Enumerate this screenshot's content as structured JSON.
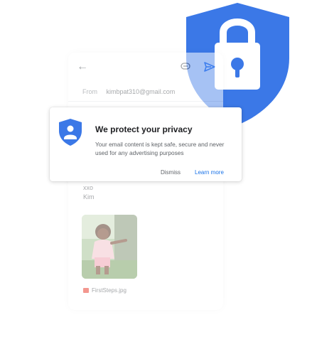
{
  "colors": {
    "brand_blue": "#3b78e7",
    "link_blue": "#1a73e8",
    "send_blue": "#4285f4",
    "attachment_red": "#ea4335",
    "title_text": "#202124",
    "secondary_text": "#5f6368"
  },
  "compose": {
    "from_label": "From",
    "from_email": "kimbpat310@gmail.com",
    "sign_off_1": "xxo",
    "sign_off_2": "Kim",
    "attachment_name": "FirstSteps.jpg",
    "icons": [
      "back-arrow-icon",
      "paperclip-icon",
      "send-icon",
      "image-file-icon"
    ]
  },
  "dialog": {
    "title": "We protect your privacy",
    "body": "Your email content is kept safe, secure and never used for any advertising purposes",
    "dismiss_label": "Dismiss",
    "learn_more_label": "Learn more",
    "icon": "privacy-shield-icon"
  },
  "hero": {
    "icon": "shield-lock-icon"
  }
}
